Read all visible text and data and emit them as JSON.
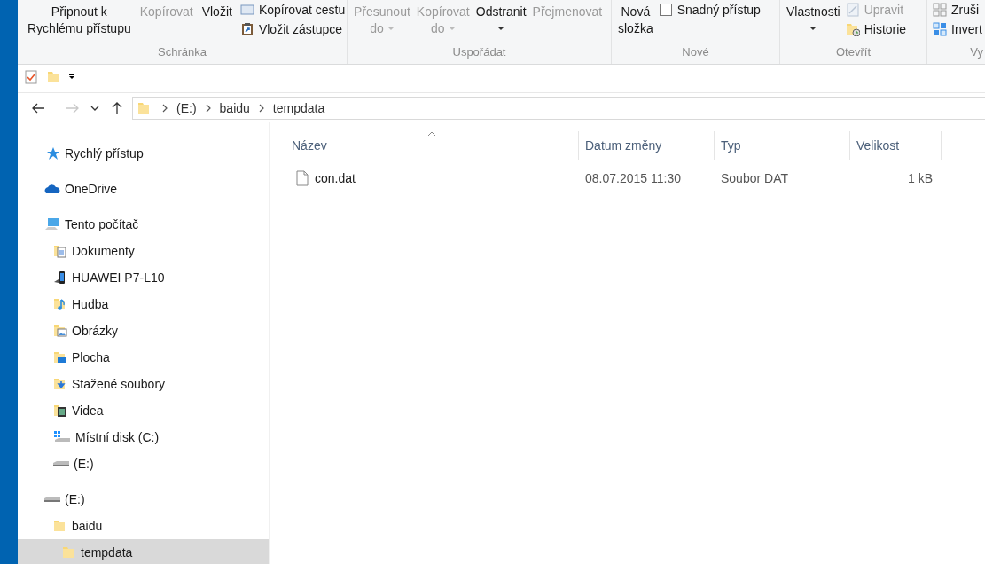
{
  "ribbon": {
    "groups": [
      {
        "label": "Schránka",
        "items": [
          {
            "kind": "large",
            "lines": [
              "Připnout k",
              "Rychlému přístupu"
            ],
            "disabled": false,
            "dropdown": false
          },
          {
            "kind": "large",
            "lines": [
              "Kopírovat"
            ],
            "disabled": true,
            "dropdown": false
          },
          {
            "kind": "large",
            "lines": [
              "Vložit"
            ],
            "disabled": false,
            "dropdown": false
          },
          {
            "kind": "stack",
            "rows": [
              {
                "kind": "path",
                "label": "Kopírovat cestu",
                "disabled": false
              },
              {
                "kind": "shortcut",
                "label": "Vložit zástupce",
                "disabled": false
              }
            ]
          }
        ]
      },
      {
        "label": "Uspořádat",
        "items": [
          {
            "kind": "large",
            "lines": [
              "Přesunout",
              "do"
            ],
            "disabled": true,
            "dropdown": true
          },
          {
            "kind": "large",
            "lines": [
              "Kopírovat",
              "do"
            ],
            "disabled": true,
            "dropdown": true
          },
          {
            "kind": "large",
            "lines": [
              "Odstranit"
            ],
            "disabled": false,
            "dropdown": true
          },
          {
            "kind": "large",
            "lines": [
              "Přejmenovat"
            ],
            "disabled": true,
            "dropdown": false
          }
        ]
      },
      {
        "label": "Nové",
        "items": [
          {
            "kind": "large",
            "lines": [
              "Nová",
              "složka"
            ],
            "disabled": false,
            "dropdown": false
          },
          {
            "kind": "stack",
            "rows": [
              {
                "kind": "access",
                "label": "Snadný přístup",
                "disabled": false
              }
            ]
          }
        ]
      },
      {
        "label": "Otevřít",
        "items": [
          {
            "kind": "large",
            "lines": [
              "Vlastnosti"
            ],
            "disabled": false,
            "dropdown": true
          },
          {
            "kind": "stack",
            "rows": [
              {
                "kind": "edit",
                "label": "Upravit",
                "disabled": true
              },
              {
                "kind": "history",
                "label": "Historie",
                "disabled": false
              }
            ]
          }
        ]
      },
      {
        "label": "Vy",
        "items": [
          {
            "kind": "stack",
            "rows": [
              {
                "kind": "grid",
                "label": "Zruši",
                "disabled": false
              },
              {
                "kind": "invert",
                "label": "Invert",
                "disabled": false
              }
            ]
          }
        ]
      }
    ]
  },
  "address_bar": {
    "path": [
      "(E:)",
      "baidu",
      "tempdata"
    ],
    "forward_disabled": true
  },
  "navigation": [
    {
      "kind": "star",
      "label": "Rychlý přístup",
      "selected": false
    },
    {
      "kind": "cloud",
      "label": "OneDrive",
      "selected": false
    },
    {
      "kind": "computer",
      "label": "Tento počítač",
      "selected": false,
      "children": [
        {
          "kind": "docs",
          "label": "Dokumenty",
          "selected": false
        },
        {
          "kind": "phone",
          "label": "HUAWEI P7-L10",
          "selected": false
        },
        {
          "kind": "music",
          "label": "Hudba",
          "selected": false
        },
        {
          "kind": "pictures",
          "label": "Obrázky",
          "selected": false
        },
        {
          "kind": "desktop",
          "label": "Plocha",
          "selected": false
        },
        {
          "kind": "downloads",
          "label": "Stažené soubory",
          "selected": false
        },
        {
          "kind": "videos",
          "label": "Videa",
          "selected": false
        },
        {
          "kind": "windisk",
          "label": "Místní disk (C:)",
          "selected": false
        },
        {
          "kind": "drive",
          "label": "(E:)",
          "selected": false
        }
      ]
    },
    {
      "kind": "drive",
      "label": "(E:)",
      "selected": false,
      "children": [
        {
          "kind": "folder",
          "label": "baidu",
          "selected": false,
          "children": [
            {
              "kind": "folder",
              "label": "tempdata",
              "selected": true
            }
          ]
        }
      ]
    }
  ],
  "table": {
    "columns": [
      {
        "label": "Název",
        "sorted": true
      },
      {
        "label": "Datum změny",
        "sorted": false
      },
      {
        "label": "Typ",
        "sorted": false
      },
      {
        "label": "Velikost",
        "sorted": false
      }
    ],
    "rows": [
      {
        "name": "con.dat",
        "date": "08.07.2015 11:30",
        "type": "Soubor DAT",
        "size": "1 kB"
      }
    ]
  }
}
